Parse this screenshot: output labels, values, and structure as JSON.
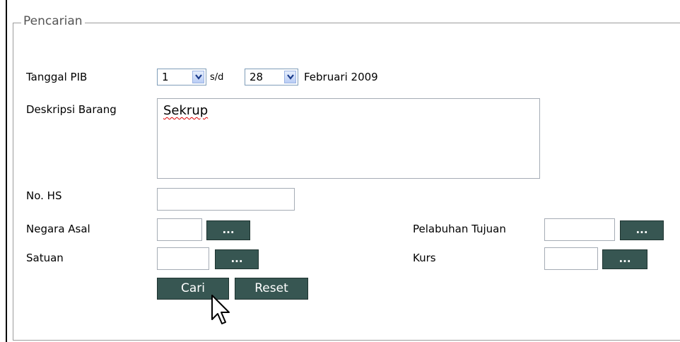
{
  "legend": "Pencarian",
  "tanggal": {
    "label": "Tanggal PIB",
    "from_value": "1",
    "separator": "s/d",
    "to_value": "28",
    "period": "Februari 2009"
  },
  "deskripsi": {
    "label": "Deskripsi Barang",
    "value": "Sekrup"
  },
  "hs": {
    "label": "No. HS",
    "value": ""
  },
  "negara": {
    "label": "Negara Asal",
    "button": "..."
  },
  "satuan": {
    "label": "Satuan",
    "button": "..."
  },
  "pelabuhan": {
    "label": "Pelabuhan Tujuan",
    "button": "..."
  },
  "kurs": {
    "label": "Kurs",
    "button": "..."
  },
  "actions": {
    "search": "Cari",
    "reset": "Reset"
  },
  "colors": {
    "button_bg": "#375652",
    "button_text": "#ffffff"
  }
}
